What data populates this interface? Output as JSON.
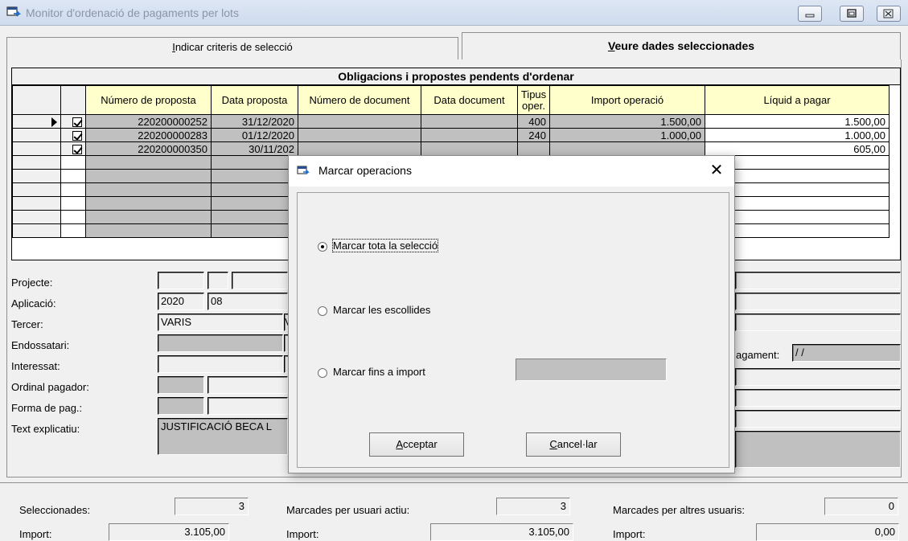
{
  "window": {
    "title": "Monitor d'ordenació de pagaments per lots"
  },
  "tabs": [
    {
      "label_pre": "",
      "label_u": "I",
      "label_post": "ndicar criteris de selecció",
      "active": false
    },
    {
      "label_pre": "",
      "label_u": "V",
      "label_post": "eure dades seleccionades",
      "active": true
    }
  ],
  "grid": {
    "caption": "Obligacions i propostes pendents d'ordenar",
    "columns": [
      "",
      "",
      "Número de proposta",
      "Data proposta",
      "Número de document",
      "Data document",
      "Tipus oper.",
      "Import operació",
      "Líquid a pagar"
    ],
    "rows": [
      {
        "current": true,
        "checked": true,
        "num_proposta": "220200000252",
        "data_proposta": "31/12/2020",
        "num_document": "",
        "data_document": "",
        "tipus": "400",
        "import": "1.500,00",
        "liquid": "1.500,00"
      },
      {
        "current": false,
        "checked": true,
        "num_proposta": "220200000283",
        "data_proposta": "01/12/2020",
        "num_document": "",
        "data_document": "",
        "tipus": "240",
        "import": "1.000,00",
        "liquid": "1.000,00"
      },
      {
        "current": false,
        "checked": true,
        "num_proposta": "220200000350",
        "data_proposta": "30/11/202",
        "num_document": "",
        "data_document": "",
        "tipus": "",
        "import": "",
        "liquid": "605,00"
      },
      {
        "current": false,
        "checked": false,
        "num_proposta": "",
        "data_proposta": "",
        "num_document": "",
        "data_document": "",
        "tipus": "",
        "import": "",
        "liquid": ""
      },
      {
        "current": false,
        "checked": false,
        "num_proposta": "",
        "data_proposta": "",
        "num_document": "",
        "data_document": "",
        "tipus": "",
        "import": "",
        "liquid": ""
      },
      {
        "current": false,
        "checked": false,
        "num_proposta": "",
        "data_proposta": "",
        "num_document": "",
        "data_document": "",
        "tipus": "",
        "import": "",
        "liquid": ""
      },
      {
        "current": false,
        "checked": false,
        "num_proposta": "",
        "data_proposta": "",
        "num_document": "",
        "data_document": "",
        "tipus": "",
        "import": "",
        "liquid": ""
      },
      {
        "current": false,
        "checked": false,
        "num_proposta": "",
        "data_proposta": "",
        "num_document": "",
        "data_document": "",
        "tipus": "",
        "import": "",
        "liquid": ""
      },
      {
        "current": false,
        "checked": false,
        "num_proposta": "",
        "data_proposta": "",
        "num_document": "",
        "data_document": "",
        "tipus": "",
        "import": "",
        "liquid": ""
      }
    ]
  },
  "details": {
    "projecte_label": "Projecte:",
    "aplicacio_label": "Aplicació:",
    "aplicacio_year": "2020",
    "aplicacio_code": "08",
    "tercer_label": "Tercer:",
    "tercer_value": "VARIS",
    "tercer_value2": "V",
    "endossatari_label": "Endossatari:",
    "interessat_label": "Interessat:",
    "ordinal_label": "Ordinal pagador:",
    "forma_label": "Forma de pag.:",
    "text_label": "Text explicatiu:",
    "text_value": "JUSTIFICACIÓ BECA L",
    "pagament_label": "agament:",
    "pagament_value": " / /"
  },
  "summary": {
    "seleccionades_label": "Seleccionades:",
    "seleccionades_value": "3",
    "import_label": "Import:",
    "import_value": "3.105,00",
    "marcades_usuari_label": "Marcades per usuari actiu:",
    "marcades_usuari_value": "3",
    "import_usuari_label": "Import:",
    "import_usuari_value": "3.105,00",
    "marcades_altres_label": "Marcades per altres usuaris:",
    "marcades_altres_value": "0",
    "import_altres_label": "Import:",
    "import_altres_value": "0,00"
  },
  "dialog": {
    "title": "Marcar operacions",
    "close_glyph": "✕",
    "options": [
      {
        "label": "Marcar tota la selecció",
        "checked": true
      },
      {
        "label": "Marcar les escollides",
        "checked": false
      },
      {
        "label": "Marcar fins a import",
        "checked": false
      }
    ],
    "accept_u": "A",
    "accept_rest": "cceptar",
    "cancel_u": "C",
    "cancel_rest": "ancel·lar"
  },
  "icons": {
    "app": "window-app-icon",
    "dialog": "dialog-app-icon",
    "minimize": "minimize-icon",
    "maximize": "maximize-icon",
    "close": "close-icon"
  },
  "colors": {
    "grid_gray": "#c0c0c0",
    "header_yellow": "#ffffcc",
    "title_inactive_text": "#8a96a8"
  }
}
